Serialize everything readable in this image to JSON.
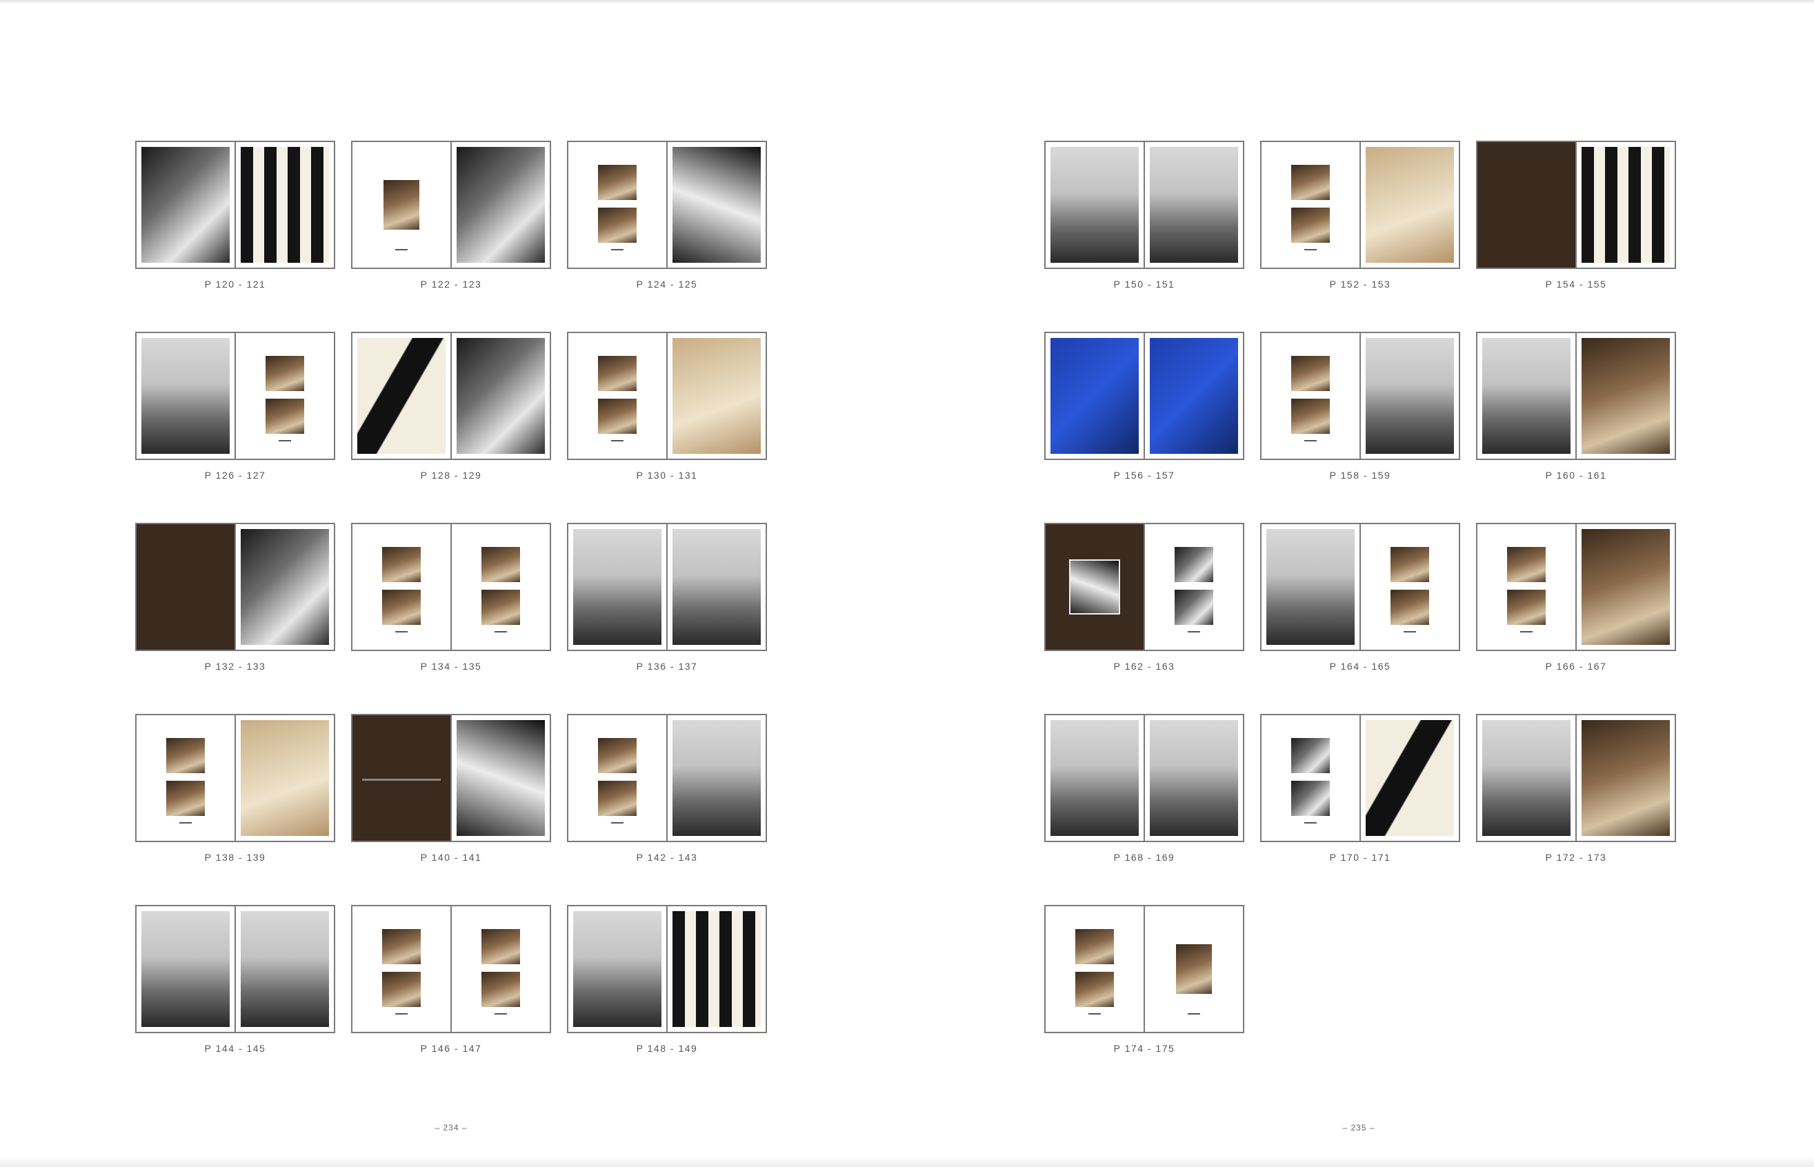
{
  "left_page": {
    "folio": "– 234 –",
    "spreads": [
      {
        "label": "P 120 - 121",
        "left": "full mono",
        "right": "full brush"
      },
      {
        "label": "P 122 - 123",
        "left": "center sepia",
        "right": "full mono"
      },
      {
        "label": "P 124 - 125",
        "left": "stack sepia",
        "right": "full bw"
      },
      {
        "label": "P 126 - 127",
        "left": "full interior",
        "right": "stack sepia"
      },
      {
        "label": "P 128 - 129",
        "left": "full abstract",
        "right": "full mono"
      },
      {
        "label": "P 130 - 131",
        "left": "stack sepia",
        "right": "full cream"
      },
      {
        "label": "P 132 - 133",
        "left": "dark-solid",
        "right": "full mono"
      },
      {
        "label": "P 134 - 135",
        "left": "stack sepia",
        "right": "stack sepia"
      },
      {
        "label": "P 136 - 137",
        "left": "full interior",
        "right": "full interior"
      },
      {
        "label": "P 138 - 139",
        "left": "stack sepia",
        "right": "full cream"
      },
      {
        "label": "P 140 - 141",
        "left": "dark-text",
        "right": "full bw"
      },
      {
        "label": "P 142 - 143",
        "left": "stack sepia",
        "right": "full interior"
      },
      {
        "label": "P 144 - 145",
        "left": "full interior",
        "right": "full interior"
      },
      {
        "label": "P 146 - 147",
        "left": "stack sepia",
        "right": "stack sepia"
      },
      {
        "label": "P 148 - 149",
        "left": "full interior",
        "right": "full brush"
      }
    ]
  },
  "right_page": {
    "folio": "– 235 –",
    "spreads": [
      {
        "label": "P 150 - 151",
        "left": "full interior",
        "right": "full interior"
      },
      {
        "label": "P 152 - 153",
        "left": "stack sepia",
        "right": "full cream"
      },
      {
        "label": "P 154 - 155",
        "left": "dark-solid",
        "right": "full brush"
      },
      {
        "label": "P 156 - 157",
        "left": "full blue",
        "right": "full blue"
      },
      {
        "label": "P 158 - 159",
        "left": "stack sepia",
        "right": "full interior"
      },
      {
        "label": "P 160 - 161",
        "left": "full interior",
        "right": "full sepia"
      },
      {
        "label": "P 162 - 163",
        "left": "dark-framed",
        "right": "stack mono"
      },
      {
        "label": "P 164 - 165",
        "left": "full interior",
        "right": "stack sepia"
      },
      {
        "label": "P 166 - 167",
        "left": "stack sepia",
        "right": "full sepia"
      },
      {
        "label": "P 168 - 169",
        "left": "full interior",
        "right": "full interior"
      },
      {
        "label": "P 170 - 171",
        "left": "stack mono",
        "right": "full abstract"
      },
      {
        "label": "P 172 - 173",
        "left": "full interior",
        "right": "full sepia"
      },
      {
        "label": "P 174 - 175",
        "left": "stack sepia",
        "right": "center sepia"
      }
    ]
  }
}
